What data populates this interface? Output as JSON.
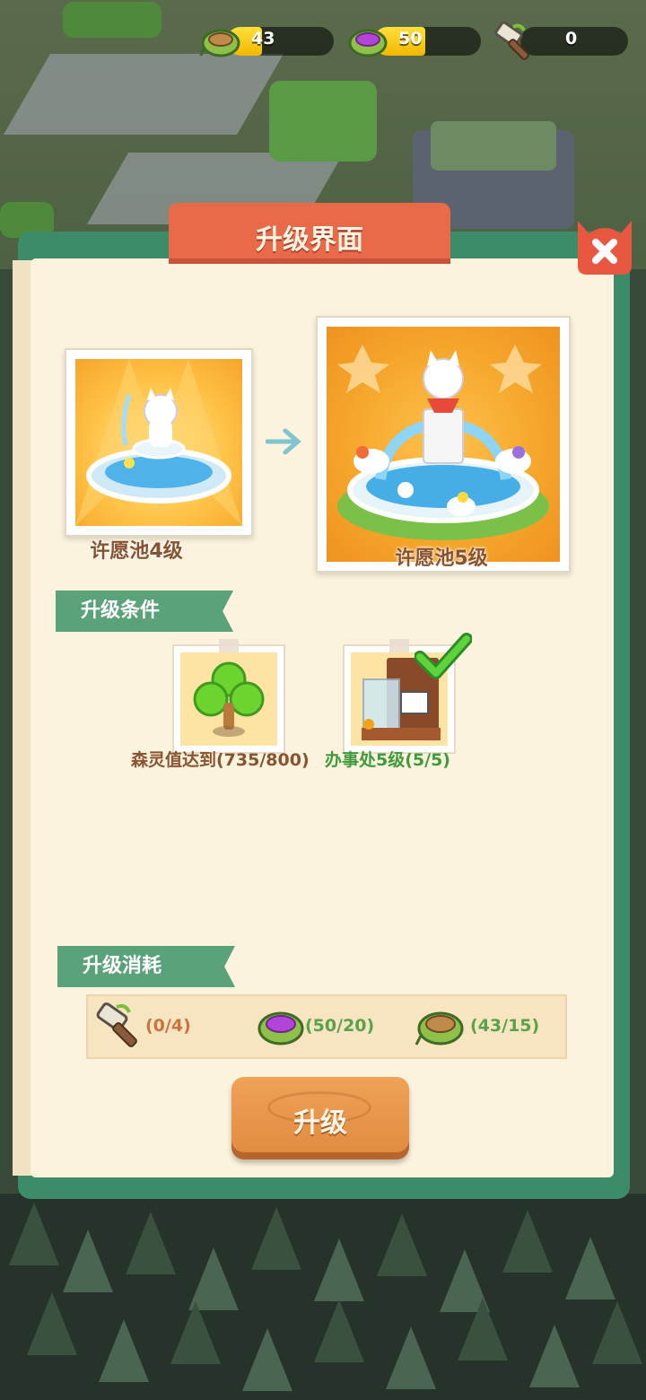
{
  "resources": [
    {
      "icon": "basket-icon",
      "value": "43",
      "fill": 0.43
    },
    {
      "icon": "purple-berry-basket-icon",
      "value": "50",
      "fill": 0.5
    },
    {
      "icon": "hammer-icon",
      "value": "0",
      "fill": 0
    }
  ],
  "dialog": {
    "title": "升级界面",
    "current": {
      "label": "许愿池4级",
      "icon": "fountain-level4-image"
    },
    "next": {
      "label": "许愿池5级",
      "icon": "fountain-level5-image"
    },
    "conditions_title": "升级条件",
    "conditions": [
      {
        "icon": "clover-icon",
        "text": "森灵值达到(735/800)",
        "met": false
      },
      {
        "icon": "office-building-icon",
        "text": "办事处5级(5/5)",
        "met": true
      }
    ],
    "cost_title": "升级消耗",
    "costs": [
      {
        "icon": "hammer-icon",
        "text": "(0/4)"
      },
      {
        "icon": "purple-berry-basket-icon",
        "text": "(50/20)"
      },
      {
        "icon": "basket-icon",
        "text": "(43/15)"
      }
    ],
    "upgrade_label": "升级"
  },
  "colors": {
    "accent_green": "#3c8c69",
    "title_red": "#e86a48",
    "button_orange": "#e08a3f",
    "met_green": "#3f9a3a",
    "unmet_brown": "#8a5330"
  }
}
